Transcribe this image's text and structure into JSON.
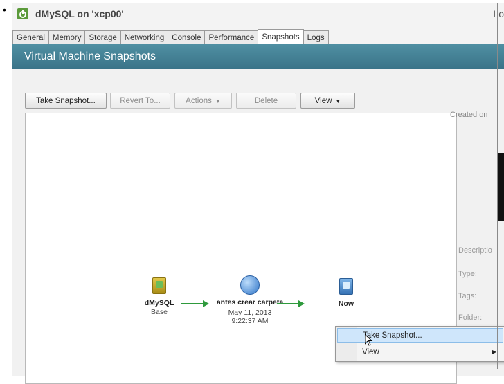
{
  "window": {
    "title": "dMySQL on 'xcp00'",
    "title_right": "Lo",
    "icon": "vm-running-icon"
  },
  "tabs": [
    {
      "label": "General"
    },
    {
      "label": "Memory"
    },
    {
      "label": "Storage"
    },
    {
      "label": "Networking"
    },
    {
      "label": "Console"
    },
    {
      "label": "Performance"
    },
    {
      "label": "Snapshots",
      "active": true
    },
    {
      "label": "Logs"
    }
  ],
  "banner": {
    "title": "Virtual Machine Snapshots"
  },
  "toolbar": {
    "take_snapshot": "Take Snapshot...",
    "revert_to": "Revert To...",
    "actions": "Actions",
    "delete": "Delete",
    "view": "View"
  },
  "snapshots": {
    "nodes": [
      {
        "name": "dMySQL",
        "sub": "Base",
        "icon": "vm-template-icon"
      },
      {
        "name": "antes crear carpeta",
        "date": "May 11, 2013",
        "time": "9:22:37 AM",
        "icon": "snapshot-icon"
      },
      {
        "name": "Now",
        "icon": "vm-current-icon"
      }
    ]
  },
  "properties": {
    "header": "Created on",
    "labels": [
      "Descriptio",
      "Type:",
      "Tags:",
      "Folder:"
    ]
  },
  "context_menu": {
    "items": [
      "Take Snapshot...",
      "View"
    ]
  },
  "colors": {
    "banner": "#3f7d91",
    "arrow": "#2e9a3c",
    "menu_highlight": "#cfe6fb"
  }
}
